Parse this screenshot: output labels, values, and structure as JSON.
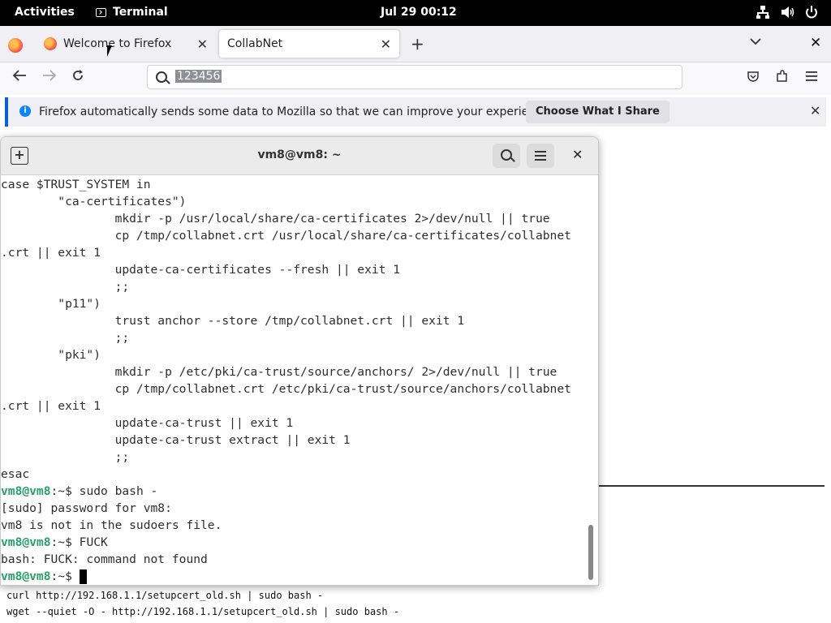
{
  "topbar": {
    "activities": "Activities",
    "app_name": "Terminal",
    "clock": "Jul 29  00:12"
  },
  "firefox": {
    "tabs": [
      {
        "label": "Welcome to Firefox",
        "active": false
      },
      {
        "label": "CollabNet",
        "active": true
      }
    ],
    "url": "123456",
    "notification": {
      "text": "Firefox automatically sends some data to Mozilla so that we can improve your experience.",
      "button": "Choose What I Share"
    },
    "page_lines": [
      "curl http://192.168.1.1/setupcert_old.sh | sudo bash -",
      "wget --quiet -O - http://192.168.1.1/setupcert_old.sh | sudo bash -"
    ]
  },
  "terminal": {
    "title": "vm8@vm8: ~",
    "lines": [
      {
        "text": "case $TRUST_SYSTEM in"
      },
      {
        "text": "        \"ca-certificates\")"
      },
      {
        "text": "                mkdir -p /usr/local/share/ca-certificates 2>/dev/null || true"
      },
      {
        "text": "                cp /tmp/collabnet.crt /usr/local/share/ca-certificates/collabnet"
      },
      {
        "text": ".crt || exit 1"
      },
      {
        "text": "                update-ca-certificates --fresh || exit 1"
      },
      {
        "text": "                ;;"
      },
      {
        "text": "        \"p11\")"
      },
      {
        "text": "                trust anchor --store /tmp/collabnet.crt || exit 1"
      },
      {
        "text": "                ;;"
      },
      {
        "text": "        \"pki\")"
      },
      {
        "text": "                mkdir -p /etc/pki/ca-trust/source/anchors/ 2>/dev/null || true"
      },
      {
        "text": "                cp /tmp/collabnet.crt /etc/pki/ca-trust/source/anchors/collabnet"
      },
      {
        "text": ".crt || exit 1"
      },
      {
        "text": "                update-ca-trust || exit 1"
      },
      {
        "text": "                update-ca-trust extract || exit 1"
      },
      {
        "text": "                ;;"
      },
      {
        "text": "esac"
      },
      {
        "prompt": "vm8@vm8",
        "dir": ":~$ ",
        "text": "sudo bash -"
      },
      {
        "text": "[sudo] password for vm8:"
      },
      {
        "text": "vm8 is not in the sudoers file."
      },
      {
        "prompt": "vm8@vm8",
        "dir": ":~$ ",
        "text": "FUCK"
      },
      {
        "text": "bash: FUCK: command not found"
      },
      {
        "prompt": "vm8@vm8",
        "dir": ":~$ ",
        "text": "",
        "cursor": true
      }
    ]
  }
}
